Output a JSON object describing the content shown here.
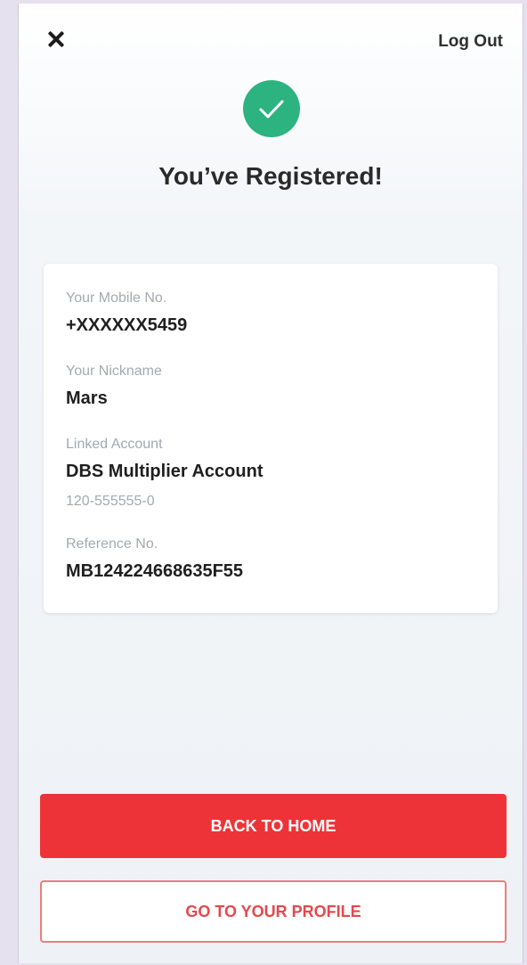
{
  "header": {
    "logout_label": "Log Out"
  },
  "success": {
    "title": "You’ve Registered!",
    "icon_color": "#2db37f"
  },
  "details": {
    "mobile_label": "Your Mobile No.",
    "mobile_value": "+XXXXXX5459",
    "nickname_label": "Your Nickname",
    "nickname_value": "Mars",
    "account_label": "Linked Account",
    "account_name": "DBS Multiplier Account",
    "account_number": "120-555555-0",
    "reference_label": "Reference No.",
    "reference_value": "MB124224668635F55"
  },
  "actions": {
    "primary_label": "BACK TO HOME",
    "secondary_label": "GO TO YOUR PROFILE",
    "primary_color": "#ee3338"
  },
  "icons": {
    "close": "close-icon",
    "success": "checkmark-icon"
  }
}
